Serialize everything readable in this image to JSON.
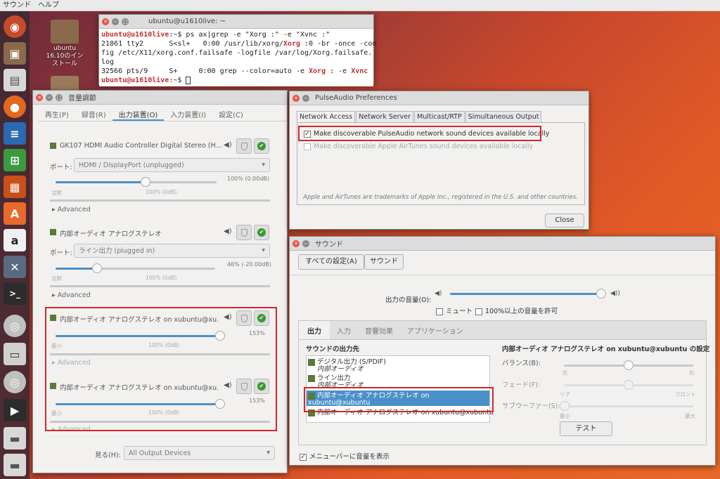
{
  "topbar": {
    "menu1": "サウンド",
    "menu2": "ヘルプ"
  },
  "desktop": {
    "icon1_line1": "ubuntu",
    "icon1_line2": "16.10のイン",
    "icon1_line3": "ストール"
  },
  "terminal": {
    "title": "ubuntu@u1610live: ~",
    "prompt": "ubuntu@u1610live",
    "prompt_suffix": ":~$ ",
    "command": "ps ax|grep -e \"Xorg :\" -e \"Xvnc :\"",
    "l2a": "21861 tty2      S<sl+   0:00 /usr/lib/xorg/",
    "l2b": "Xorg",
    "l2c": " :0 -br -once -con",
    "l3": "fig /etc/X11/xorg.conf.failsafe -logfile /var/log/Xorg.failsafe.",
    "l4": "log",
    "l5a": "32566 pts/9     S+     0:00 grep --color=auto -e ",
    "l5b": "Xorg :",
    "l5c": " -e ",
    "l5d": "Xvnc :"
  },
  "mixer": {
    "title": "音量調節",
    "tabs": [
      "再生(P)",
      "録音(R)",
      "出力装置(O)",
      "入力装置(I)",
      "設定(C)"
    ],
    "port_label": "ポート:",
    "devices": [
      {
        "name": "GK107 HDMI Audio Controller Digital Stereo (H...",
        "port": "HDMI / DisplayPort (unplugged)",
        "value": "100% (0.00dB)",
        "tick_left": "沈黙",
        "tick_mid": "100% (0dB)",
        "advanced": "Advanced",
        "level": 1.0
      },
      {
        "name": "内部オーディオ アナログステレオ",
        "port": "ライン出力 (plugged in)",
        "value": "46% (-20.00dB)",
        "tick_left": "沈黙",
        "tick_mid": "100% (0dB)",
        "advanced": "Advanced",
        "level": 0.46
      },
      {
        "name": "内部オーディオ アナログステレオ on xubuntu@xu...",
        "value": "153%",
        "tick_left": "最小",
        "tick_mid": "100% (0dB)",
        "advanced": "Advanced",
        "level": 1.53
      },
      {
        "name": "内部オーディオ アナログステレオ on xubuntu@xu...",
        "value": "153%",
        "tick_left": "最小",
        "tick_mid": "100% (0dB)",
        "advanced": "Advanced",
        "level": 1.53
      }
    ],
    "show_label": "見る(H):",
    "show_value": "All Output Devices"
  },
  "pulse": {
    "title": "PulseAudio Preferences",
    "tabs": [
      "Network Access",
      "Network Server",
      "Multicast/RTP",
      "Simultaneous Output"
    ],
    "check1": "Make discoverable PulseAudio network sound devices available locally",
    "check2": "Make discoverable Apple AirTunes sound devices available locally",
    "note": "Apple and AirTunes are trademarks of Apple Inc., registered in the U.S. and other countries.",
    "close": "Close"
  },
  "sound": {
    "title": "サウンド",
    "all_settings": "すべての設定(A)",
    "breadcrumb": "サウンド",
    "output_volume_label": "出力の音量(O):",
    "mute": "ミュート",
    "over100": "100%以上の音量を許可",
    "tabs": [
      "出力",
      "入力",
      "音響効果",
      "アプリケーション"
    ],
    "dest_header": "サウンドの出力先",
    "devices": [
      {
        "line1": "デジタル出力 (S/PDIF)",
        "line2": "内部オーディオ"
      },
      {
        "line1": "ライン出力",
        "line2": "内部オーディオ"
      },
      {
        "line1": "内部オーディオ アナログステレオ on xubuntu@xubuntu",
        "line2": ""
      },
      {
        "line1": "内部オーディオ アナログステレオ on xubuntu@xubuntu",
        "line2": ""
      }
    ],
    "settings_header": "内部オーディオ アナログステレオ on xubuntu@xubuntu の設定",
    "balance": "バランス(B):",
    "bal_l": "左",
    "bal_r": "右",
    "fade": "フェード(F):",
    "fade_l": "リア",
    "fade_r": "フロント",
    "woofer": "サブウーファー(S):",
    "woof_l": "最小",
    "woof_r": "最大",
    "test": "テスト",
    "menubar": "メニューバーに音量を表示"
  }
}
